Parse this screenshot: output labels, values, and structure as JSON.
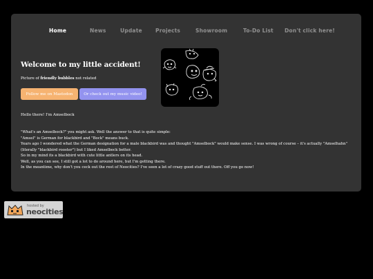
{
  "nav": {
    "items": [
      {
        "label": "Home",
        "active": true
      },
      {
        "label": "News",
        "active": false
      },
      {
        "label": "Update",
        "active": false
      },
      {
        "label": "Projects",
        "active": false
      },
      {
        "label": "Showroom",
        "active": false
      },
      {
        "label": "To-Do List",
        "active": false
      },
      {
        "label": "Don't click here!",
        "active": false
      }
    ]
  },
  "hero": {
    "title": "Welcome to my little accident!",
    "caption_prefix": "Picture of ",
    "caption_bold": "friendly bubbles",
    "caption_suffix": " not related"
  },
  "buttons": {
    "mastodon": "Follow me on Mastodon",
    "music": "Or check out my music video!"
  },
  "greeting": "Hello there! I'm Amselbock",
  "story": [
    "\"What's an Amselbock?\" you might ask. Well the answer to that is quite simple:",
    "\"Amsel\" is German for blackbird and \"Bock\" means buck.",
    "Years ago I wondered what the German designation for a male blackbird was and thought \"Amselbock\" would make sense. I was wrong of course – it's actually \"Amselhahn\"",
    "(literally \"blackbird rooster\") but I liked Amselbock better.",
    "So in my mind its a blackbird with cute little antlers on its head.",
    "Well, as you can see, I still got a lot to do around here, but I'm getting there.",
    "In the meantime, why don't you ceck out the rest of Neocities? I've seen a lot of crazy good stuff out there. Off you go now!"
  ],
  "badge": {
    "small": "hosted by",
    "big": "neocities"
  },
  "colors": {
    "background": "#000000",
    "panel": "#333333",
    "nav_inactive": "#8e8e8e",
    "button_orange": "#f6b371",
    "button_purple": "#9393ef"
  }
}
